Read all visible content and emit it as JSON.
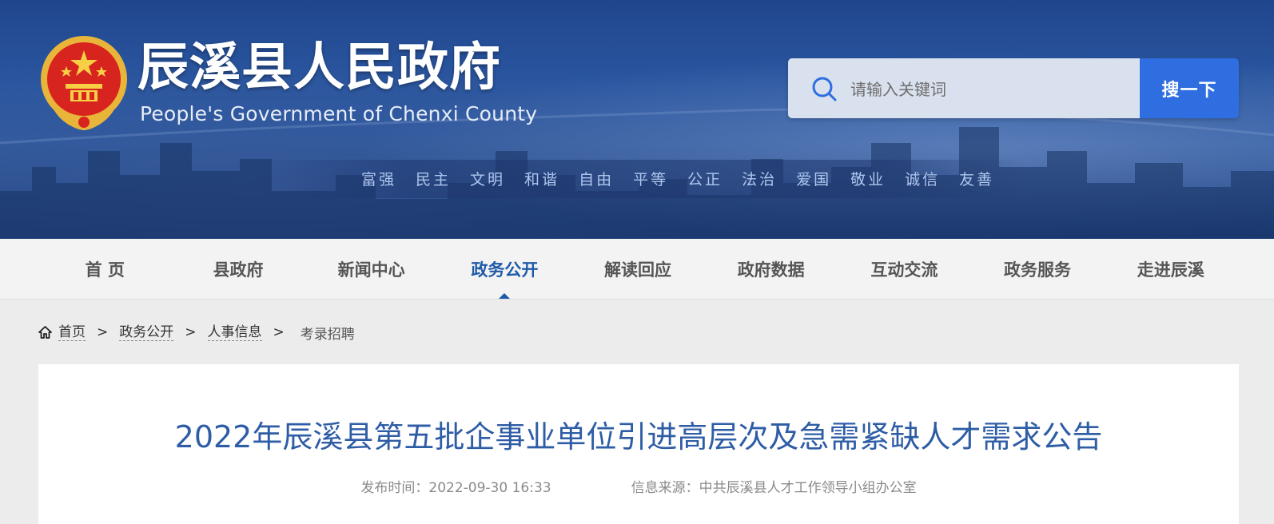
{
  "header": {
    "title": "辰溪县人民政府",
    "subtitle": "People's Government of Chenxi County",
    "emblem_icon": "national-emblem-icon",
    "slogans": [
      "富强",
      "民主",
      "文明",
      "和谐",
      "自由",
      "平等",
      "公正",
      "法治",
      "爱国",
      "敬业",
      "诚信",
      "友善"
    ],
    "colors": {
      "banner": "#2a56a0",
      "slogan": "#aec6ee"
    }
  },
  "search": {
    "placeholder": "请输入关键词",
    "button_label": "搜一下",
    "icon": "search-icon",
    "button_color": "#2f6ee0"
  },
  "nav": {
    "items": [
      {
        "label": "首 页"
      },
      {
        "label": "县政府"
      },
      {
        "label": "新闻中心"
      },
      {
        "label": "政务公开"
      },
      {
        "label": "解读回应"
      },
      {
        "label": "政府数据"
      },
      {
        "label": "互动交流"
      },
      {
        "label": "政务服务"
      },
      {
        "label": "走进辰溪"
      }
    ],
    "active": "政务公开",
    "active_color": "#1f5aa8"
  },
  "breadcrumb": {
    "home_icon": "home-icon",
    "items": [
      "首页",
      "政务公开",
      "人事信息"
    ],
    "separator": ">",
    "current": "考录招聘"
  },
  "article": {
    "title": "2022年辰溪县第五批企事业单位引进高层次及急需紧缺人才需求公告",
    "publish_label": "发布时间：",
    "publish_time": "2022-09-30 16:33",
    "source_label": "信息来源：",
    "source": "中共辰溪县人才工作领导小组办公室",
    "title_color": "#2e5da6"
  }
}
